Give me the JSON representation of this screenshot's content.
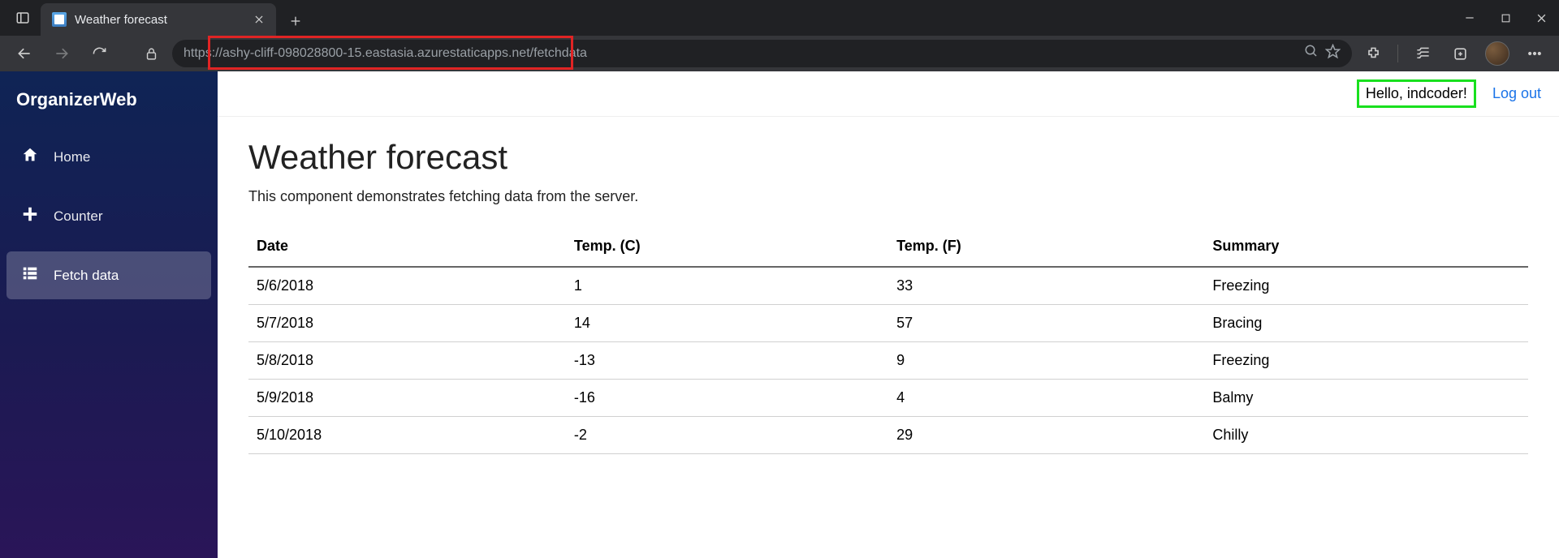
{
  "browser": {
    "tab_title": "Weather forecast",
    "url": "https://ashy-cliff-098028800-15.eastasia.azurestaticapps.net/fetchdata"
  },
  "sidebar": {
    "brand": "OrganizerWeb",
    "items": [
      {
        "label": "Home"
      },
      {
        "label": "Counter"
      },
      {
        "label": "Fetch data"
      }
    ],
    "active_index": 2
  },
  "header": {
    "greeting": "Hello, indcoder!",
    "logout_label": "Log out"
  },
  "page": {
    "title": "Weather forecast",
    "subtitle": "This component demonstrates fetching data from the server."
  },
  "table": {
    "columns": [
      "Date",
      "Temp. (C)",
      "Temp. (F)",
      "Summary"
    ],
    "rows": [
      {
        "date": "5/6/2018",
        "temp_c": "1",
        "temp_f": "33",
        "summary": "Freezing"
      },
      {
        "date": "5/7/2018",
        "temp_c": "14",
        "temp_f": "57",
        "summary": "Bracing"
      },
      {
        "date": "5/8/2018",
        "temp_c": "-13",
        "temp_f": "9",
        "summary": "Freezing"
      },
      {
        "date": "5/9/2018",
        "temp_c": "-16",
        "temp_f": "4",
        "summary": "Balmy"
      },
      {
        "date": "5/10/2018",
        "temp_c": "-2",
        "temp_f": "29",
        "summary": "Chilly"
      }
    ]
  },
  "annotations": {
    "url_highlight_color": "#e02424",
    "greeting_highlight_color": "#19e01e"
  }
}
